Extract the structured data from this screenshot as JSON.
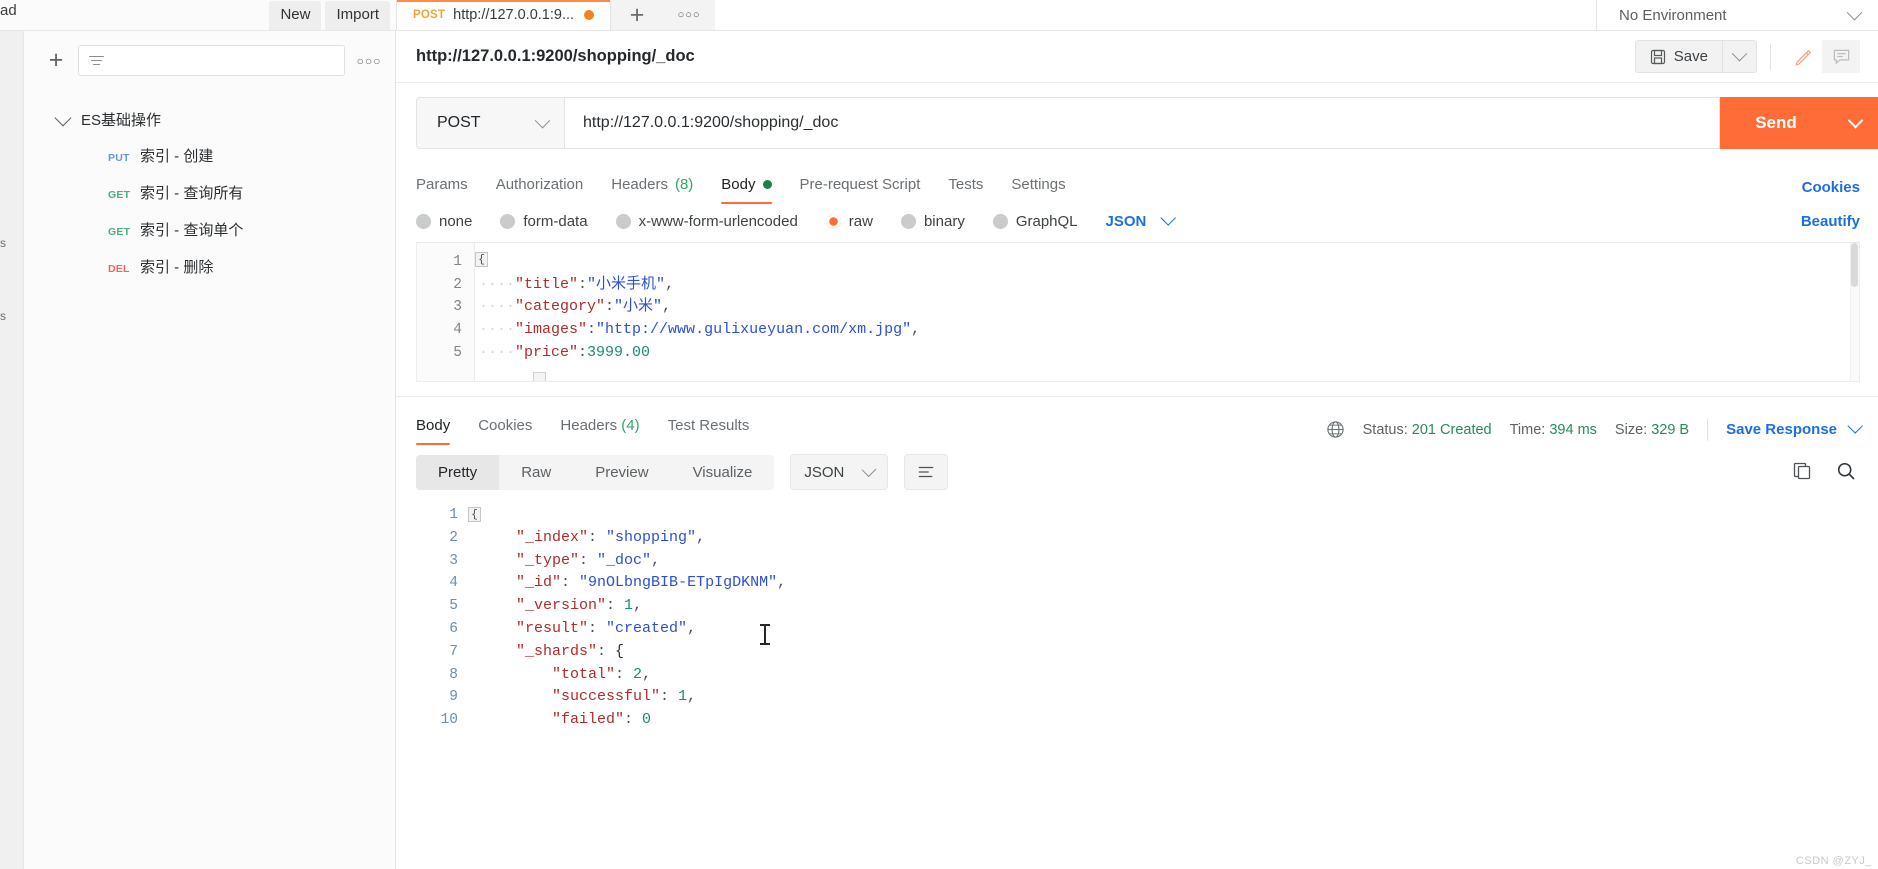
{
  "topbar": {
    "pad_label": "ad",
    "new_label": "New",
    "import_label": "Import",
    "request_tab": {
      "method": "POST",
      "title": "http://127.0.0.1:9...",
      "unsaved_dot": "unsaved"
    },
    "new_tab_icon": "plus-icon",
    "tab_options_icon": "more-options-icon",
    "environment": {
      "label": "No Environment",
      "chevron": "chevron-down-icon"
    }
  },
  "sidebar": {
    "add_icon": "plus-icon",
    "filter_placeholder": "",
    "filter_icon": "filter-icon",
    "more_icon": "more-options-icon",
    "rail_labels": [
      "s",
      "s"
    ],
    "collection": {
      "name": "ES基础操作",
      "caret": "chevron-down-icon"
    },
    "requests": [
      {
        "method": "PUT",
        "name": "索引 - 创建"
      },
      {
        "method": "GET",
        "name": "索引 - 查询所有"
      },
      {
        "method": "GET",
        "name": "索引 - 查询单个"
      },
      {
        "method": "DEL",
        "name": "索引 - 删除"
      }
    ]
  },
  "request": {
    "title": "http://127.0.0.1:9200/shopping/_doc",
    "options_icon": "more-options-icon",
    "save_label": "Save",
    "save_icon": "floppy-disk-icon",
    "save_caret": "chevron-down-icon",
    "edit_icon": "pencil-icon",
    "comment_icon": "comment-icon",
    "method": "POST",
    "method_caret": "chevron-down-icon",
    "url": "http://127.0.0.1:9200/shopping/_doc",
    "send_label": "Send",
    "send_caret": "chevron-down-icon",
    "tabs": [
      {
        "label": "Params",
        "active": false
      },
      {
        "label": "Authorization",
        "active": false
      },
      {
        "label": "Headers",
        "count": "(8)",
        "active": false
      },
      {
        "label": "Body",
        "active": true,
        "dot": true
      },
      {
        "label": "Pre-request Script",
        "active": false
      },
      {
        "label": "Tests",
        "active": false
      },
      {
        "label": "Settings",
        "active": false
      }
    ],
    "cookies_link": "Cookies",
    "body_types": [
      {
        "label": "none",
        "selected": false
      },
      {
        "label": "form-data",
        "selected": false
      },
      {
        "label": "x-www-form-urlencoded",
        "selected": false
      },
      {
        "label": "raw",
        "selected": true
      },
      {
        "label": "binary",
        "selected": false
      },
      {
        "label": "GraphQL",
        "selected": false
      }
    ],
    "raw_format": "JSON",
    "raw_format_caret": "chevron-down-icon",
    "beautify_label": "Beautify",
    "body_lines": [
      {
        "n": "1",
        "open_brace": "{"
      },
      {
        "n": "2",
        "indent": "····",
        "key": "\"title\"",
        "colon": ":",
        "value": "\"小米手机\"",
        "value_type": "string",
        "comma": ","
      },
      {
        "n": "3",
        "indent": "····",
        "key": "\"category\"",
        "colon": ":",
        "value": "\"小米\"",
        "value_type": "string",
        "comma": ","
      },
      {
        "n": "4",
        "indent": "····",
        "key": "\"images\"",
        "colon": ":",
        "value": "\"http://www.gulixueyuan.com/xm.jpg\"",
        "value_type": "string",
        "comma": ","
      },
      {
        "n": "5",
        "indent": "····",
        "key": "\"price\"",
        "colon": ":",
        "value": "3999.00",
        "value_type": "number",
        "comma": ""
      }
    ]
  },
  "response": {
    "tabs": [
      {
        "label": "Body",
        "active": true
      },
      {
        "label": "Cookies",
        "active": false
      },
      {
        "label": "Headers",
        "count": "(4)",
        "active": false
      },
      {
        "label": "Test Results",
        "active": false
      }
    ],
    "globe_icon": "globe-icon",
    "status_label": "Status:",
    "status_value": "201 Created",
    "time_label": "Time:",
    "time_value": "394 ms",
    "size_label": "Size:",
    "size_value": "329 B",
    "save_response_label": "Save Response",
    "save_response_caret": "chevron-down-icon",
    "view_modes": [
      {
        "label": "Pretty",
        "active": true
      },
      {
        "label": "Raw",
        "active": false
      },
      {
        "label": "Preview",
        "active": false
      },
      {
        "label": "Visualize",
        "active": false
      }
    ],
    "format": "JSON",
    "format_caret": "chevron-down-icon",
    "wrap_icon": "wrap-lines-icon",
    "copy_icon": "copy-icon",
    "search_icon": "search-icon",
    "body_lines": [
      {
        "n": "1",
        "open_brace": "{"
      },
      {
        "n": "2",
        "indent": "    ",
        "key": "\"_index\"",
        "colon": ": ",
        "value": "\"shopping\"",
        "value_type": "string",
        "comma": ","
      },
      {
        "n": "3",
        "indent": "    ",
        "key": "\"_type\"",
        "colon": ": ",
        "value": "\"_doc\"",
        "value_type": "string",
        "comma": ","
      },
      {
        "n": "4",
        "indent": "    ",
        "key": "\"_id\"",
        "colon": ": ",
        "value": "\"9nOLbngBIB-ETpIgDKNM\"",
        "value_type": "string",
        "comma": ","
      },
      {
        "n": "5",
        "indent": "    ",
        "key": "\"_version\"",
        "colon": ": ",
        "value": "1",
        "value_type": "number",
        "comma": ","
      },
      {
        "n": "6",
        "indent": "    ",
        "key": "\"result\"",
        "colon": ": ",
        "value": "\"created\"",
        "value_type": "string",
        "comma": ","
      },
      {
        "n": "7",
        "indent": "    ",
        "key": "\"_shards\"",
        "colon": ": ",
        "value": "{",
        "value_type": "brace",
        "comma": ""
      },
      {
        "n": "8",
        "indent": "        ",
        "key": "\"total\"",
        "colon": ": ",
        "value": "2",
        "value_type": "number",
        "comma": ","
      },
      {
        "n": "9",
        "indent": "        ",
        "key": "\"successful\"",
        "colon": ": ",
        "value": "1",
        "value_type": "number",
        "comma": ","
      },
      {
        "n": "10",
        "indent": "        ",
        "key": "\"failed\"",
        "colon": ": ",
        "value": "0",
        "value_type": "number",
        "comma": ""
      }
    ]
  },
  "watermark": "CSDN @ZYJ_",
  "colors": {
    "accent": "#ff6c37",
    "link": "#1d6fe0",
    "success": "#2b8a5a",
    "key": "#b02b2b",
    "string": "#2d4fd6",
    "number": "#1e8a7a"
  }
}
